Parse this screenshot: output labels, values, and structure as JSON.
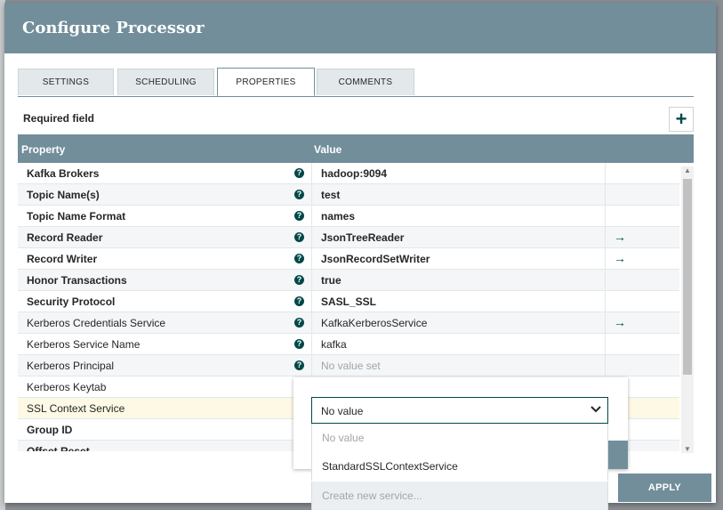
{
  "dialog": {
    "title": "Configure Processor"
  },
  "tabs": [
    {
      "label": "SETTINGS"
    },
    {
      "label": "SCHEDULING"
    },
    {
      "label": "PROPERTIES"
    },
    {
      "label": "COMMENTS"
    }
  ],
  "required_label": "Required field",
  "add_button": "+",
  "table": {
    "header_property": "Property",
    "header_value": "Value",
    "rows": [
      {
        "property": "Kafka Brokers",
        "value": "hadoop:9094",
        "required": true,
        "help": "?",
        "arrow": ""
      },
      {
        "property": "Topic Name(s)",
        "value": "test",
        "required": true,
        "help": "?",
        "arrow": ""
      },
      {
        "property": "Topic Name Format",
        "value": "names",
        "required": true,
        "help": "?",
        "arrow": ""
      },
      {
        "property": "Record Reader",
        "value": "JsonTreeReader",
        "required": true,
        "help": "?",
        "arrow": "→"
      },
      {
        "property": "Record Writer",
        "value": "JsonRecordSetWriter",
        "required": true,
        "help": "?",
        "arrow": "→"
      },
      {
        "property": "Honor Transactions",
        "value": "true",
        "required": true,
        "help": "?",
        "arrow": ""
      },
      {
        "property": "Security Protocol",
        "value": "SASL_SSL",
        "required": true,
        "help": "?",
        "arrow": ""
      },
      {
        "property": "Kerberos Credentials Service",
        "value": "KafkaKerberosService",
        "required": false,
        "help": "?",
        "arrow": "→"
      },
      {
        "property": "Kerberos Service Name",
        "value": "kafka",
        "required": false,
        "help": "?",
        "arrow": ""
      },
      {
        "property": "Kerberos Principal",
        "value": "No value set",
        "required": false,
        "help": "?",
        "arrow": "",
        "empty": true
      },
      {
        "property": "Kerberos Keytab",
        "value": "",
        "required": false,
        "help": "",
        "arrow": ""
      },
      {
        "property": "SSL Context Service",
        "value": "",
        "required": false,
        "help": "",
        "arrow": "",
        "highlight": true
      },
      {
        "property": "Group ID",
        "value": "",
        "required": true,
        "help": "",
        "arrow": ""
      },
      {
        "property": "Offset Reset",
        "value": "",
        "required": true,
        "help": "",
        "arrow": ""
      }
    ]
  },
  "dropdown": {
    "selected": "No value",
    "chevron": "⌄",
    "options": [
      "No value",
      "StandardSSLContextService"
    ],
    "create_label": "Create new service..."
  },
  "apply_label": "APPLY",
  "colors": {
    "header": "#728e9b",
    "accent": "#004849"
  }
}
